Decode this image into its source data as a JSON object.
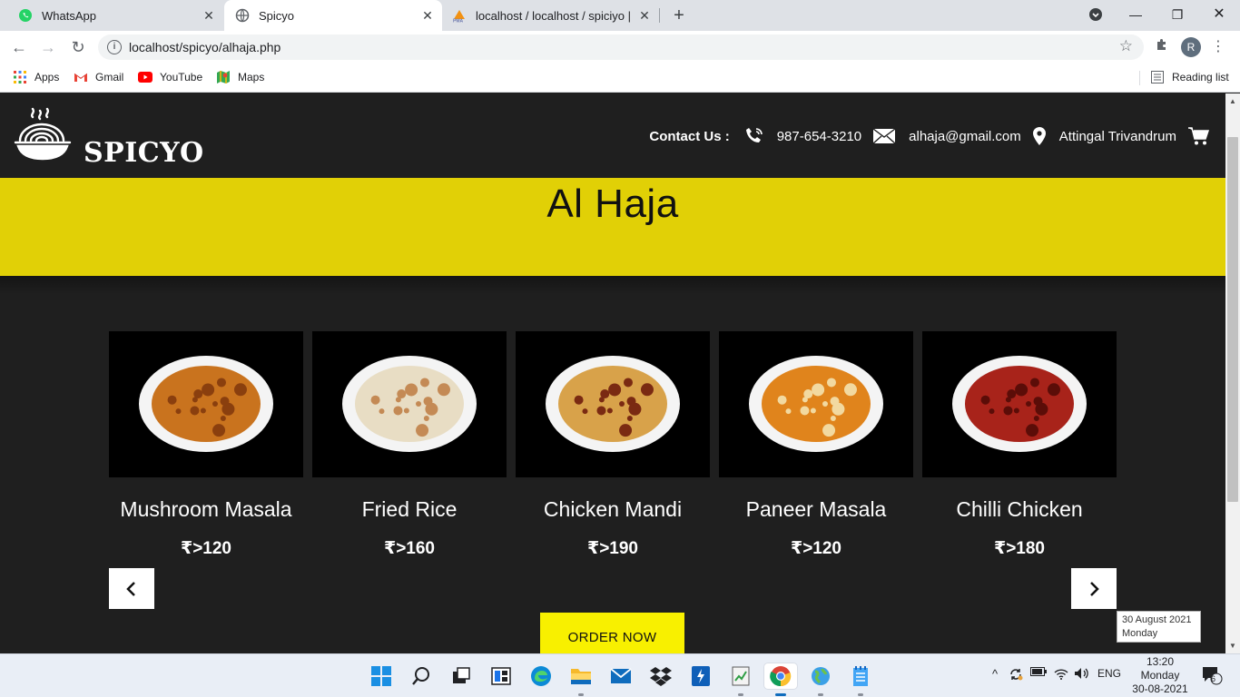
{
  "browser": {
    "tabs": [
      {
        "title": "WhatsApp",
        "active": false
      },
      {
        "title": "Spicyo",
        "active": true
      },
      {
        "title": "localhost / localhost / spiciyo | ph",
        "active": false
      }
    ],
    "url": "localhost/spicyo/alhaja.php",
    "profile_initial": "R",
    "bookmarks": [
      {
        "label": "Apps"
      },
      {
        "label": "Gmail"
      },
      {
        "label": "YouTube"
      },
      {
        "label": "Maps"
      }
    ],
    "reading_list": "Reading list"
  },
  "site": {
    "logo_text": "SPICYO",
    "contact_label": "Contact Us :",
    "phone": "987-654-3210",
    "email": "alhaja@gmail.com",
    "location": "Attingal Trivandrum",
    "restaurant_name": "Al Haja",
    "menu_items": [
      {
        "name": "Mushroom Masala",
        "price": "₹>120",
        "plate": "#c9731e",
        "accent": "#8a3f0e"
      },
      {
        "name": "Fried Rice",
        "price": "₹>160",
        "plate": "#e8ddc4",
        "accent": "#c48a55"
      },
      {
        "name": "Chicken Mandi",
        "price": "₹>190",
        "plate": "#d8a24a",
        "accent": "#7a2a12"
      },
      {
        "name": "Paneer Masala",
        "price": "₹>120",
        "plate": "#e0841c",
        "accent": "#f2d9a0"
      },
      {
        "name": "Chilli Chicken",
        "price": "₹>180",
        "plate": "#a8231a",
        "accent": "#5b0d08"
      }
    ],
    "prev_icon": "chevron-left-icon",
    "next_icon": "chevron-right-icon",
    "order_button": "ORDER NOW"
  },
  "tooltip": {
    "date": "30 August 2021",
    "day": "Monday"
  },
  "taskbar": {
    "language": "ENG",
    "time": "13:20",
    "day": "Monday",
    "date": "30-08-2021",
    "notification_count": "6"
  },
  "colors": {
    "banner": "#e1d006",
    "order_button": "#f8f000",
    "page_bg": "#1f1f1f"
  }
}
